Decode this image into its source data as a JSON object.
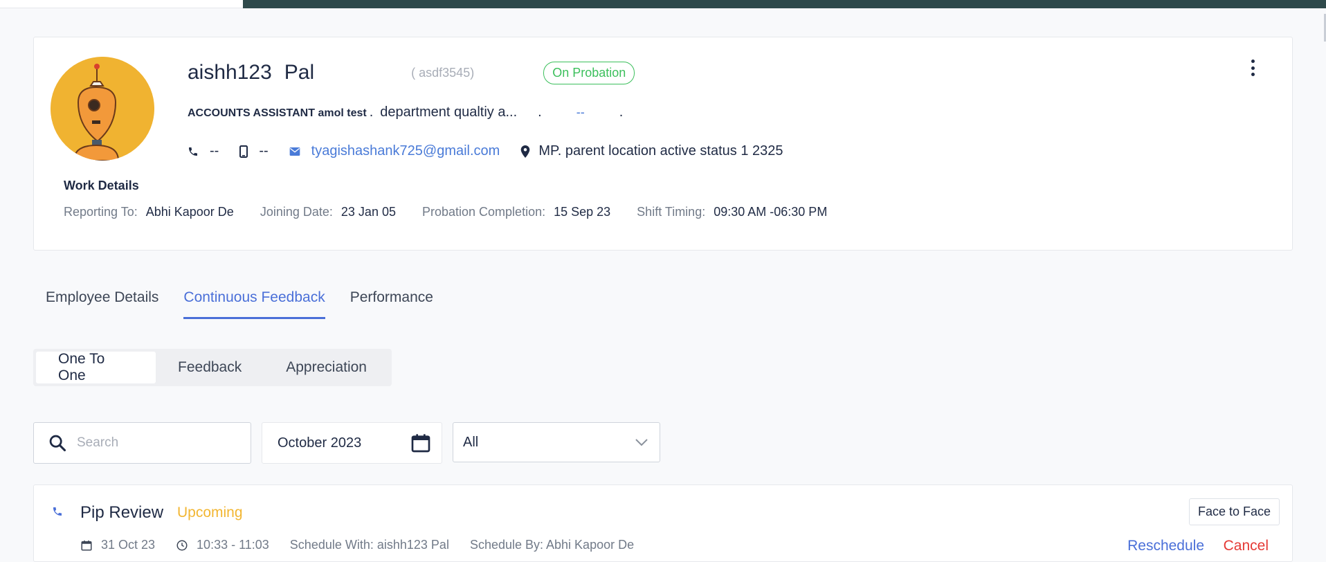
{
  "profile": {
    "first_name": "aishh123",
    "last_name": "Pal",
    "emp_code": "( asdf3545)",
    "status": "On Probation",
    "designation": "ACCOUNTS ASSISTANT amol test",
    "designation_sep": ".",
    "department": "department qualtiy a...",
    "department_sep": ".",
    "extra_link": "--",
    "extra_sep": ".",
    "phone": "--",
    "mobile": "--",
    "email": "tyagishashank725@gmail.com",
    "location": "MP. parent location active status 1 2325"
  },
  "work_details": {
    "title": "Work Details",
    "reporting_to_label": "Reporting To:",
    "reporting_to": "Abhi Kapoor  De",
    "joining_label": "Joining Date:",
    "joining": "23 Jan 05",
    "probation_label": "Probation Completion:",
    "probation": "15 Sep 23",
    "shift_label": "Shift Timing:",
    "shift": "09:30 AM -06:30 PM"
  },
  "tabs": [
    {
      "label": "Employee Details"
    },
    {
      "label": "Continuous Feedback"
    },
    {
      "label": "Performance"
    }
  ],
  "subtabs": [
    {
      "label": "One To One"
    },
    {
      "label": "Feedback"
    },
    {
      "label": "Appreciation"
    }
  ],
  "filters": {
    "search_placeholder": "Search",
    "month": "October  2023",
    "status": "All"
  },
  "meeting": {
    "title": "Pip Review",
    "status": "Upcoming",
    "type": "Face to Face",
    "date": "31 Oct 23",
    "time": "10:33 - 11:03",
    "schedule_with": "Schedule With: aishh123 Pal",
    "schedule_by": "Schedule By: Abhi Kapoor De",
    "reschedule_label": "Reschedule",
    "cancel_label": "Cancel"
  },
  "colors": {
    "accent": "#4a6fd8",
    "link": "#4a7bd8",
    "probation_green": "#3bbf5b",
    "upcoming_yellow": "#f2b632",
    "cancel_red": "#e53935",
    "header_dark": "#2f4a4b"
  },
  "icons": {
    "avatar": "robot-avatar",
    "more": "more-vertical-icon",
    "phone": "phone-icon",
    "mobile": "mobile-icon",
    "email": "email-icon",
    "location": "location-pin-icon",
    "search": "search-icon",
    "calendar": "calendar-icon",
    "chevron": "chevron-down-icon",
    "clock": "clock-icon"
  }
}
